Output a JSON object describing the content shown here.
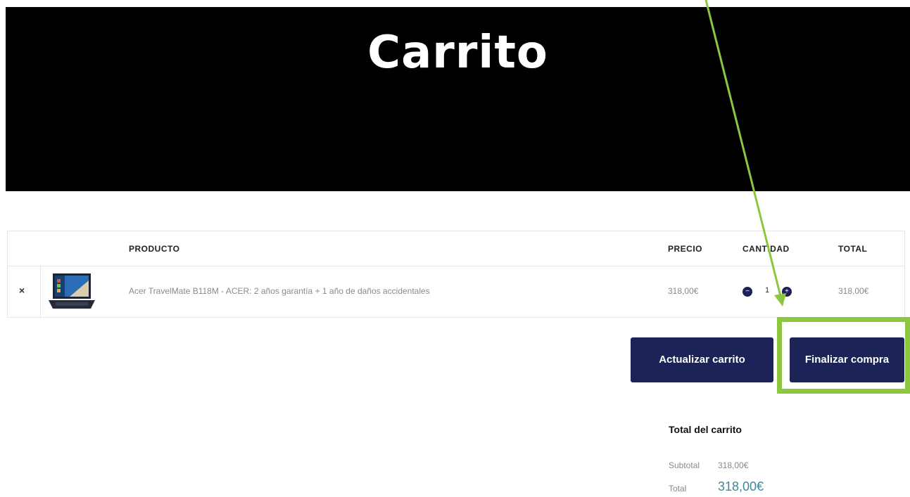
{
  "hero": {
    "title": "Carrito"
  },
  "cart": {
    "headers": {
      "product": "PRODUCTO",
      "price": "PRECIO",
      "quantity": "CANTIDAD",
      "total": "TOTAL"
    },
    "items": [
      {
        "remove_label": "×",
        "thumbnail": "laptop-thumbnail",
        "name": "Acer TravelMate B118M - ACER: 2 años garantía + 1 año de daños accidentales",
        "price": "318,00€",
        "quantity": "1",
        "total": "318,00€"
      }
    ]
  },
  "actions": {
    "update": "Actualizar carrito",
    "checkout": "Finalizar compra"
  },
  "totals": {
    "title": "Total del carrito",
    "subtotal_label": "Subtotal",
    "subtotal_value": "318,00€",
    "total_label": "Total",
    "total_value": "318,00€"
  },
  "colors": {
    "header_bg": "#000000",
    "button_bg": "#1e2357",
    "annotation": "#8dc63f",
    "total_accent": "#3a8a9a"
  }
}
